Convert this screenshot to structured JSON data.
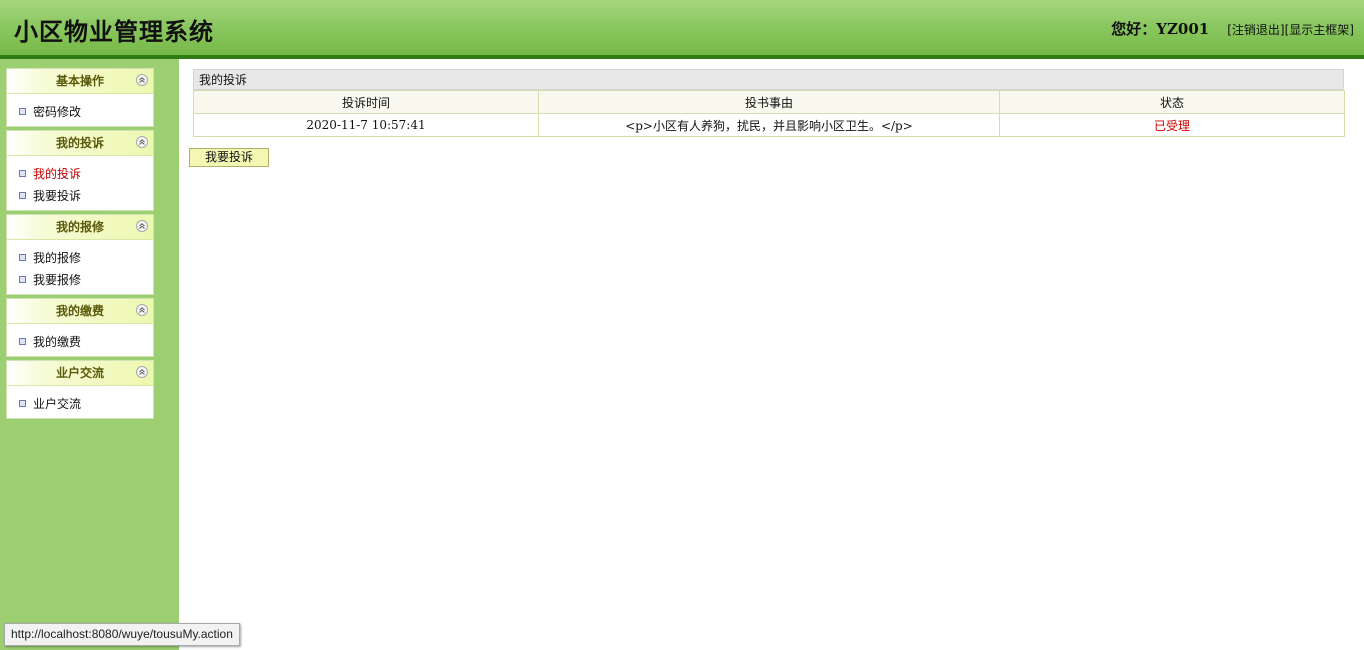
{
  "header": {
    "app_title": "小区物业管理系统",
    "greeting": "您好：YZ001",
    "logout_link": "[注销退出]",
    "show_frame_link": "[显示主框架]"
  },
  "sidebar": {
    "panels": [
      {
        "title": "基本操作",
        "items": [
          {
            "label": "密码修改"
          }
        ]
      },
      {
        "title": "我的投诉",
        "items": [
          {
            "label": "我的投诉",
            "active": true
          },
          {
            "label": "我要投诉"
          }
        ]
      },
      {
        "title": "我的报修",
        "items": [
          {
            "label": "我的报修"
          },
          {
            "label": "我要报修"
          }
        ]
      },
      {
        "title": "我的缴费",
        "items": [
          {
            "label": "我的缴费"
          }
        ]
      },
      {
        "title": "业户交流",
        "items": [
          {
            "label": "业户交流"
          }
        ]
      }
    ]
  },
  "main": {
    "list_title": "我的投诉",
    "columns": [
      "投诉时间",
      "投书事由",
      "状态"
    ],
    "rows": [
      {
        "time": "2020-11-7 10:57:41",
        "reason": "<p>小区有人养狗，扰民，并且影响小区卫生。</p>",
        "status": "已受理"
      }
    ],
    "add_button": "我要投诉"
  },
  "statusbar": {
    "url": "http://localhost:8080/wuye/tousuMy.action"
  },
  "colors": {
    "header_green": "#8cc862",
    "header_line": "#2d7d14",
    "sidebar_bg": "#9ccf72",
    "active_red": "#c00000",
    "status_red": "#d00000",
    "button_bg": "#f2f7b4"
  }
}
